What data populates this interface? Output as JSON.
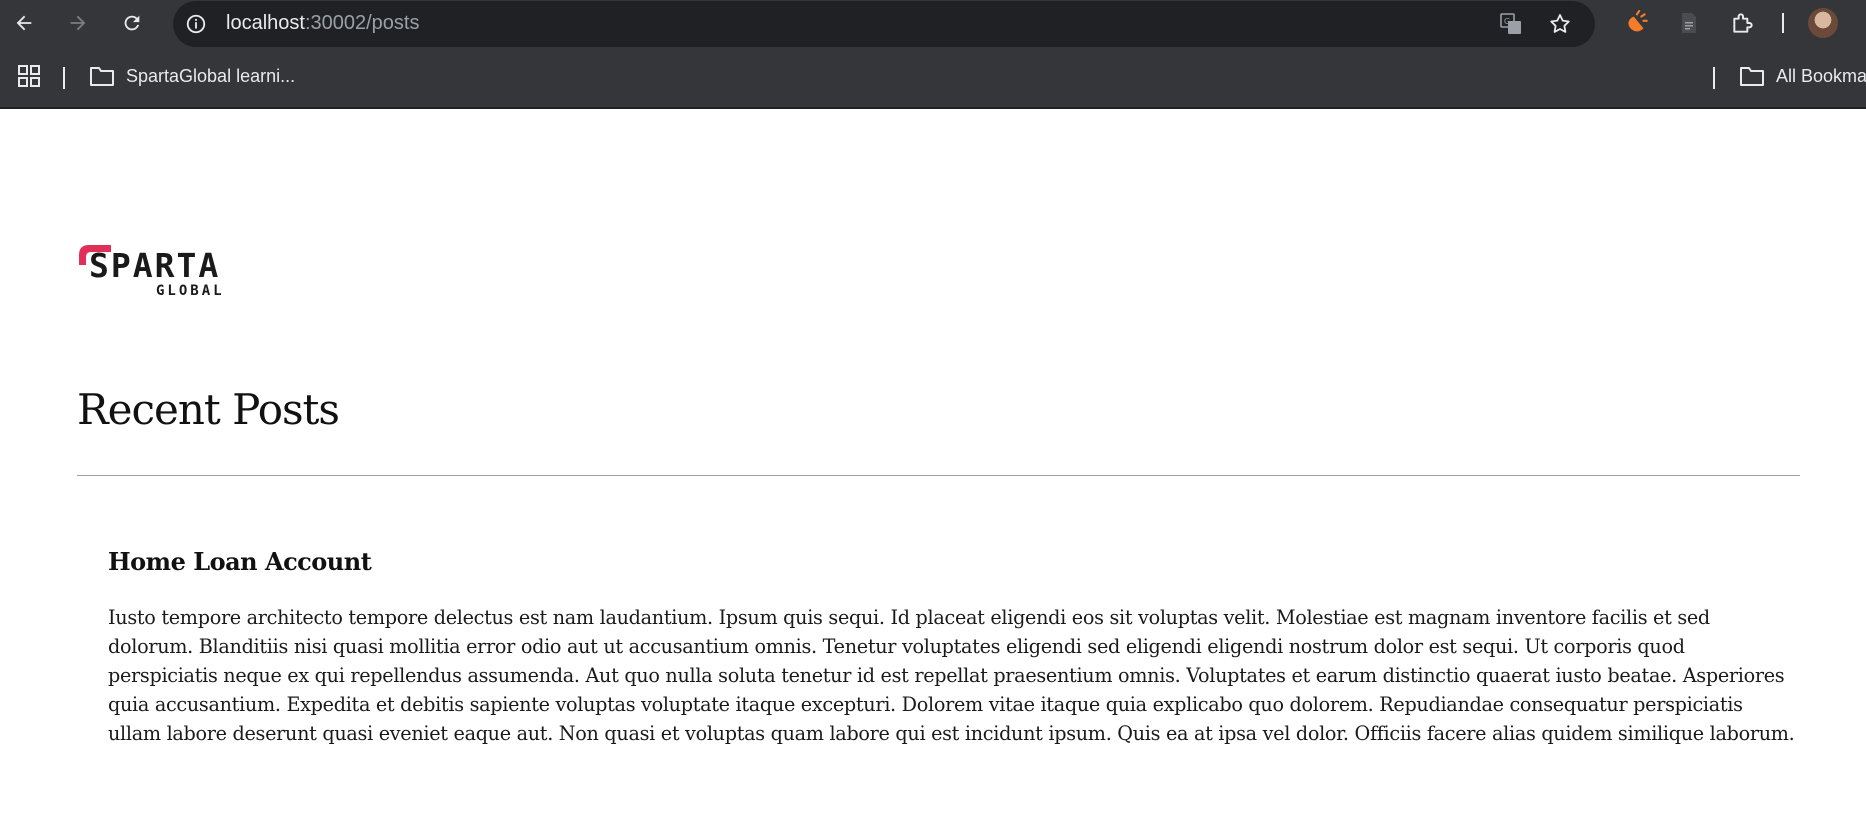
{
  "browser": {
    "url_host": "localhost",
    "url_path": ":30002/posts",
    "bookmarks": [
      {
        "label": "SpartaGlobal learni..."
      },
      {
        "label": "All Bookma"
      }
    ]
  },
  "logo": {
    "brand_top": "SPARTA",
    "brand_bottom": "GLOBAL",
    "accent_color": "#e0305a"
  },
  "page": {
    "title": "Recent Posts",
    "posts": [
      {
        "title": "Home Loan Account",
        "body": "Iusto tempore architecto tempore delectus est nam laudantium. Ipsum quis sequi. Id placeat eligendi eos sit voluptas velit. Molestiae est magnam inventore facilis et sed dolorum. Blanditiis nisi quasi mollitia error odio aut ut accusantium omnis. Tenetur voluptates eligendi sed eligendi eligendi nostrum dolor est sequi. Ut corporis quod perspiciatis neque ex qui repellendus assumenda. Aut quo nulla soluta tenetur id est repellat praesentium omnis. Voluptates et earum distinctio quaerat iusto beatae. Asperiores quia accusantium. Expedita et debitis sapiente voluptas voluptate itaque excepturi. Dolorem vitae itaque quia explicabo quo dolorem. Repudiandae consequatur perspiciatis ullam labore deserunt quasi eveniet eaque aut. Non quasi et voluptas quam labore qui est incidunt ipsum. Quis ea at ipsa vel dolor. Officiis facere alias quidem similique laborum."
      }
    ]
  },
  "icons": {
    "back": "back-arrow-icon",
    "forward": "forward-arrow-icon",
    "reload": "reload-icon",
    "info": "site-info-icon",
    "translate": "translate-icon",
    "bookmark_star": "bookmark-star-icon",
    "extension_orange": "extension-icon",
    "document": "document-icon",
    "extensions_puzzle": "puzzle-icon",
    "apps_grid": "apps-grid-icon",
    "folder": "folder-icon"
  }
}
